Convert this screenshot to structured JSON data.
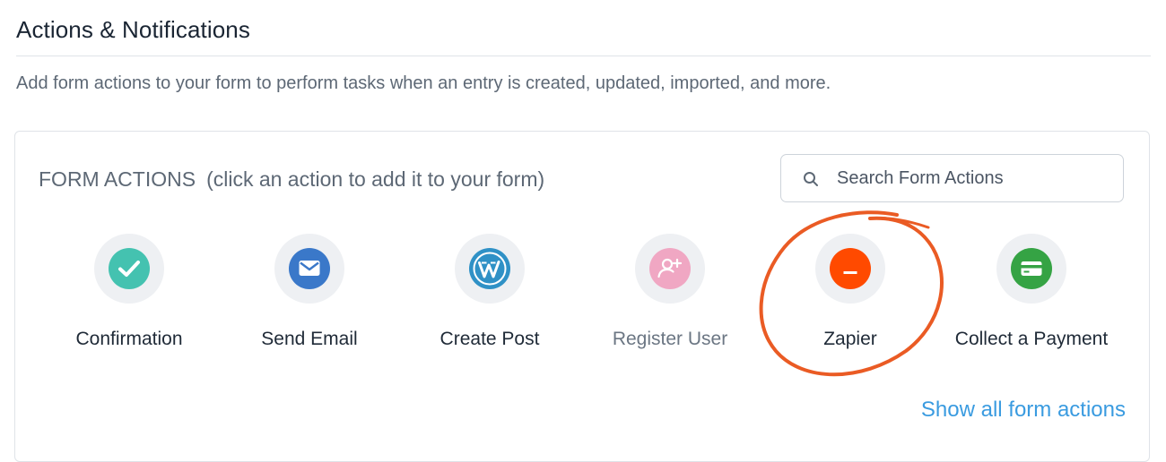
{
  "header": {
    "title": "Actions & Notifications",
    "description": "Add form actions to your form to perform tasks when an entry is created, updated, imported, and more."
  },
  "panel": {
    "heading": "FORM ACTIONS",
    "hint": "(click an action to add it to your form)",
    "search": {
      "placeholder": "Search Form Actions",
      "value": ""
    },
    "actions": [
      {
        "label": "Confirmation",
        "icon": "check-circle-icon",
        "color": "#44c2b0",
        "enabled": true
      },
      {
        "label": "Send Email",
        "icon": "envelope-icon",
        "color": "#3a78c9",
        "enabled": true
      },
      {
        "label": "Create Post",
        "icon": "wordpress-icon",
        "color": "#2f91c6",
        "enabled": true
      },
      {
        "label": "Register User",
        "icon": "user-add-icon",
        "color": "#f0a7c3",
        "enabled": false
      },
      {
        "label": "Zapier",
        "icon": "zapier-icon",
        "color": "#ff4a00",
        "enabled": true
      },
      {
        "label": "Collect a Payment",
        "icon": "credit-card-icon",
        "color": "#35a344",
        "enabled": true
      }
    ],
    "show_all_link": "Show all form actions"
  },
  "colors": {
    "accent_link": "#3a9be0",
    "annotation_circle": "#ea5b24"
  }
}
